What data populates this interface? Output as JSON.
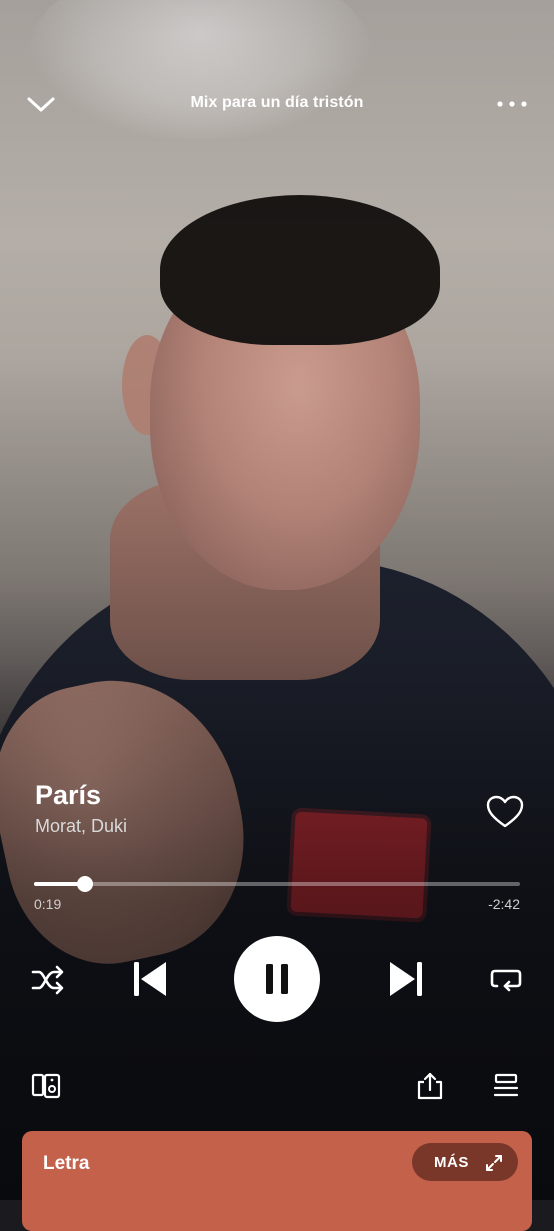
{
  "header": {
    "title": "Mix para un día tristón",
    "collapse_icon": "chevron-down-icon",
    "menu_icon": "more-horizontal-icon"
  },
  "track": {
    "title": "París",
    "artists": "Morat, Duki",
    "liked": false
  },
  "playback": {
    "elapsed": "0:19",
    "remaining": "-2:42",
    "progress_fraction": 0.105,
    "state": "playing"
  },
  "controls": {
    "shuffle_icon": "shuffle-icon",
    "previous_icon": "skip-previous-icon",
    "pause_icon": "pause-icon",
    "next_icon": "skip-next-icon",
    "repeat_icon": "repeat-icon"
  },
  "bottom_bar": {
    "devices_icon": "connect-device-icon",
    "share_icon": "share-icon",
    "queue_icon": "queue-icon"
  },
  "lyrics": {
    "label": "Letra",
    "more_label": "MÁS",
    "card_color": "#c4614b"
  }
}
